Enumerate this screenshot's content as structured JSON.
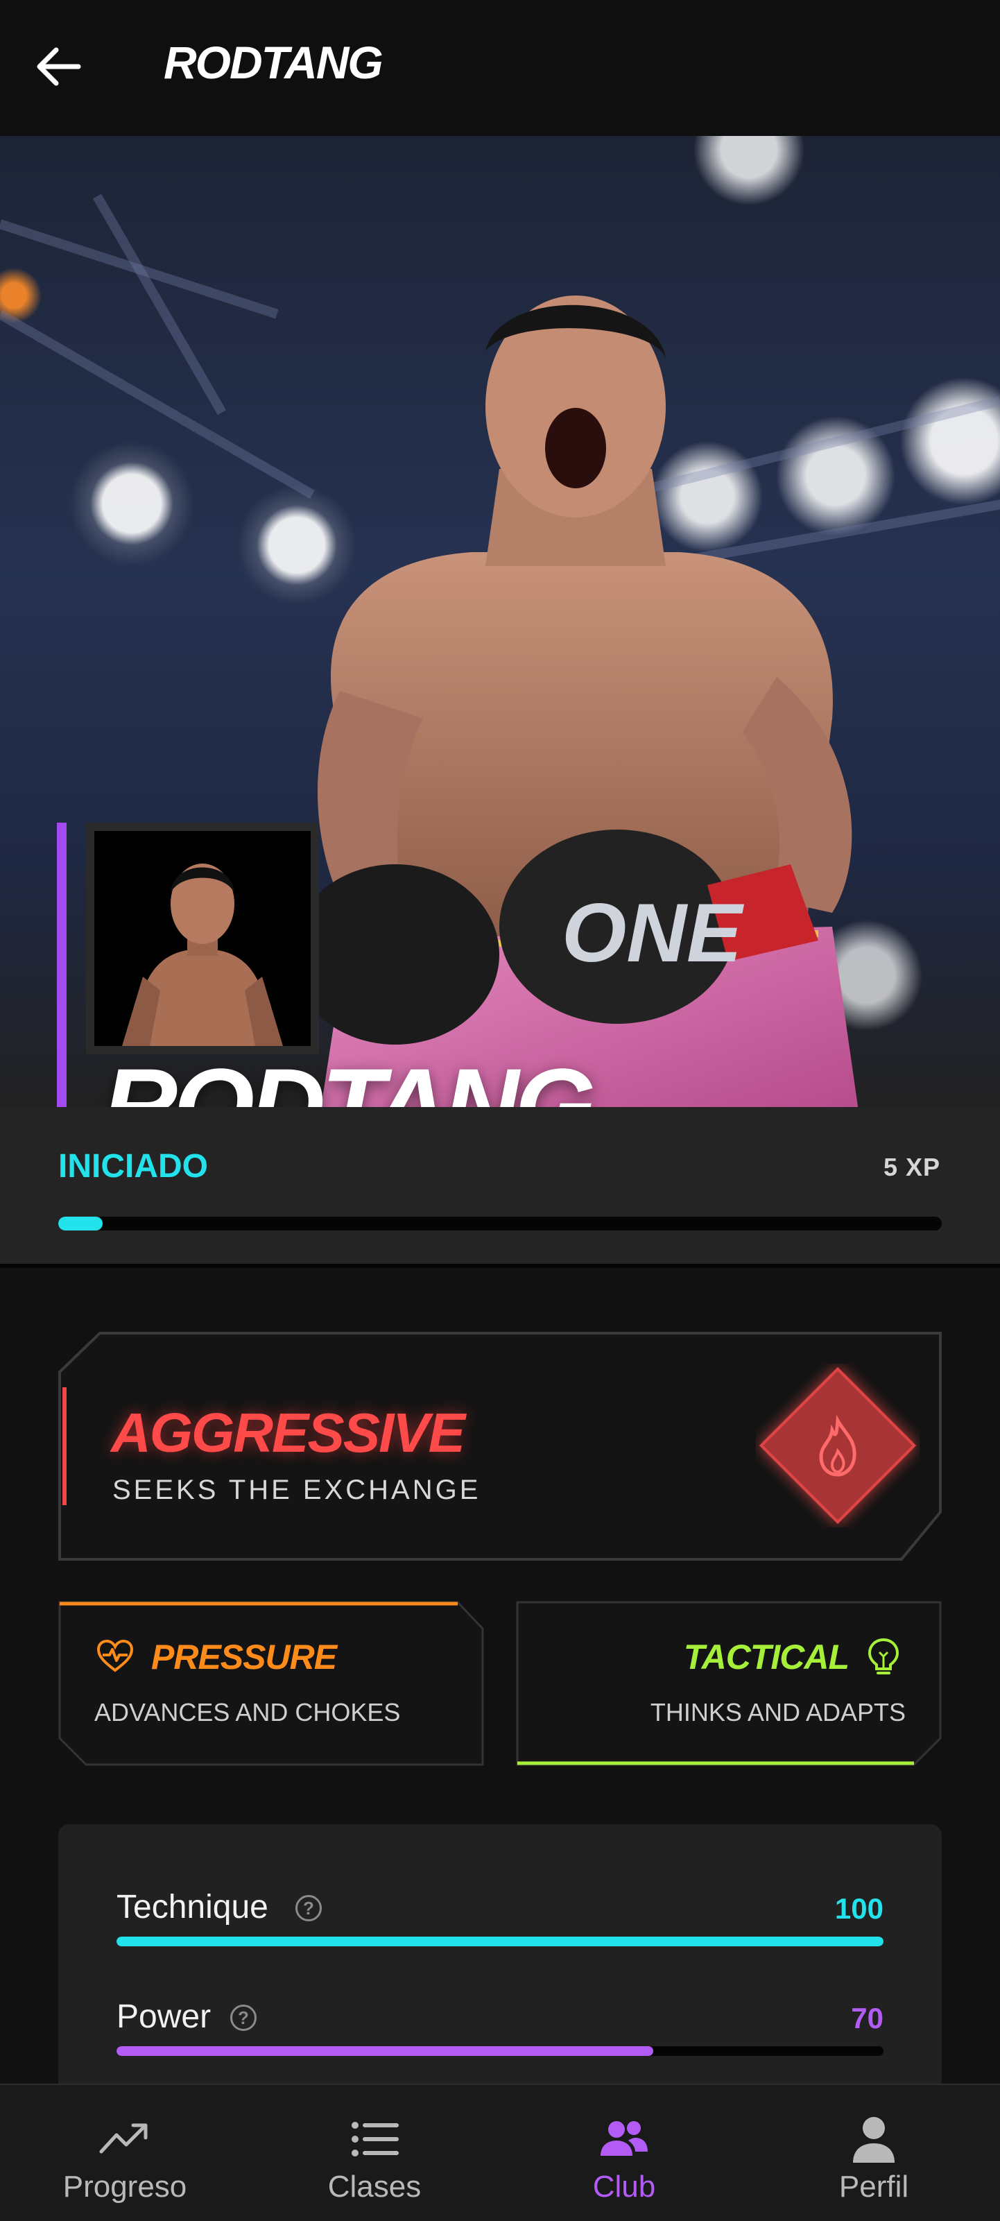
{
  "header": {
    "title": "RODTANG"
  },
  "hero": {
    "name": "RODTANG"
  },
  "level": {
    "name": "INICIADO",
    "xp": "5 XP",
    "progress_percent": 5
  },
  "style": {
    "title": "AGGRESSIVE",
    "subtitle": "SEEKS THE EXCHANGE",
    "color": "#ff4a4a",
    "icon": "flame-icon"
  },
  "traits": [
    {
      "title": "PRESSURE",
      "subtitle": "ADVANCES AND CHOKES",
      "color": "#ff8c1a",
      "icon": "heart-pulse-icon"
    },
    {
      "title": "TACTICAL",
      "subtitle": "THINKS AND ADAPTS",
      "color": "#a6f03a",
      "icon": "lightbulb-icon"
    }
  ],
  "stats": [
    {
      "label": "Technique",
      "value": "100",
      "percent": 100,
      "color": "#22e3ec"
    },
    {
      "label": "Power",
      "value": "70",
      "percent": 70,
      "color": "#b35cf5"
    }
  ],
  "nav": {
    "items": [
      {
        "label": "Progreso",
        "icon": "trending-up-icon"
      },
      {
        "label": "Clases",
        "icon": "list-icon"
      },
      {
        "label": "Club",
        "icon": "users-icon",
        "active": true
      },
      {
        "label": "Perfil",
        "icon": "person-icon"
      }
    ]
  },
  "colors": {
    "cyan": "#22e3ec",
    "purple": "#b35cf5",
    "red": "#ff4a4a",
    "orange": "#ff8c1a",
    "green": "#a6f03a"
  }
}
